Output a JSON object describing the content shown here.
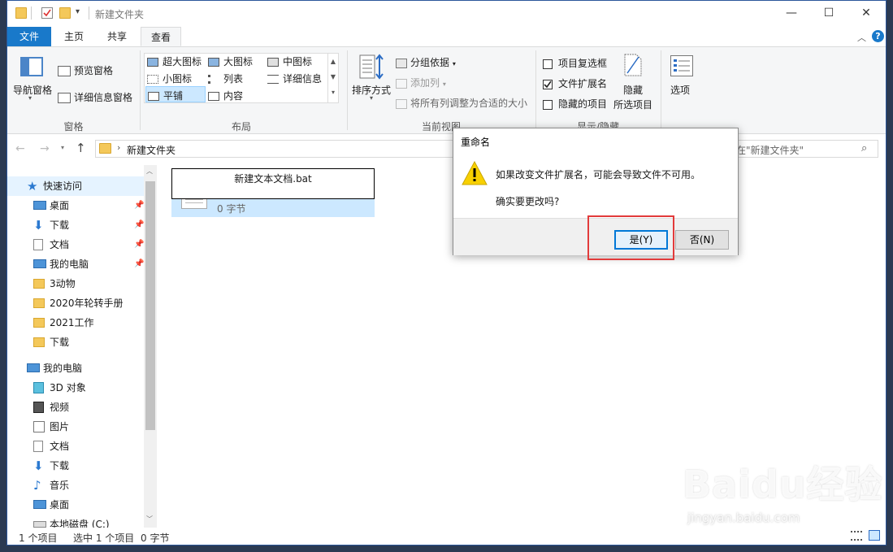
{
  "window": {
    "title": "新建文件夹",
    "controls": {
      "minimize": "—",
      "maximize": "☐",
      "close": "✕"
    }
  },
  "menu": {
    "tabs": [
      "文件",
      "主页",
      "共享",
      "查看"
    ],
    "active_tab": "查看",
    "help": "?"
  },
  "ribbon": {
    "panes": {
      "label": "窗格",
      "nav_pane": "导航窗格",
      "preview_pane": "预览窗格",
      "details_pane": "详细信息窗格"
    },
    "layout": {
      "label": "布局",
      "items": [
        "超大图标",
        "大图标",
        "中图标",
        "小图标",
        "列表",
        "详细信息",
        "平铺",
        "内容"
      ],
      "selected": "平铺"
    },
    "current_view": {
      "label": "当前视图",
      "sort": "排序方式",
      "group_by": "分组依据",
      "add_column": "添加列",
      "fit_columns": "将所有列调整为合适的大小"
    },
    "show_hide": {
      "label": "显示/隐藏",
      "item_checkboxes": {
        "label": "项目复选框",
        "checked": false
      },
      "file_extensions": {
        "label": "文件扩展名",
        "checked": true
      },
      "hidden_items": {
        "label": "隐藏的项目",
        "checked": false
      },
      "hide_selected_line1": "隐藏",
      "hide_selected_line2": "所选项目"
    },
    "options": "选项"
  },
  "navbar": {
    "address": "新建文件夹",
    "search_placeholder": "在\"新建文件夹\""
  },
  "sidebar": {
    "quick_access": "快速访问",
    "quick_items": [
      {
        "label": "桌面",
        "icon": "desktop-icon",
        "pinned": true
      },
      {
        "label": "下载",
        "icon": "download-icon",
        "pinned": true
      },
      {
        "label": "文档",
        "icon": "document-icon",
        "pinned": true
      },
      {
        "label": "我的电脑",
        "icon": "computer-icon",
        "pinned": true
      },
      {
        "label": "3动物",
        "icon": "folder-icon",
        "pinned": false
      },
      {
        "label": "2020年轮转手册",
        "icon": "folder-icon",
        "pinned": false
      },
      {
        "label": "2021工作",
        "icon": "folder-icon",
        "pinned": false
      },
      {
        "label": "下载",
        "icon": "folder-icon",
        "pinned": false
      }
    ],
    "this_pc": "我的电脑",
    "pc_items": [
      {
        "label": "3D 对象",
        "icon": "cube-icon"
      },
      {
        "label": "视频",
        "icon": "video-icon"
      },
      {
        "label": "图片",
        "icon": "picture-icon"
      },
      {
        "label": "文档",
        "icon": "document-icon"
      },
      {
        "label": "下载",
        "icon": "download-icon"
      },
      {
        "label": "音乐",
        "icon": "music-icon"
      },
      {
        "label": "桌面",
        "icon": "desktop-icon"
      },
      {
        "label": "本地磁盘 (C:)",
        "icon": "drive-icon"
      }
    ]
  },
  "file": {
    "rename_value": "新建文本文档.bat",
    "size": "0 字节"
  },
  "status": {
    "items": "1 个项目",
    "selected": "选中 1 个项目",
    "size": "0 字节"
  },
  "dialog": {
    "title": "重命名",
    "message": "如果改变文件扩展名，可能会导致文件不可用。",
    "question": "确实要更改吗?",
    "yes": "是(Y)",
    "no": "否(N)"
  },
  "watermark": {
    "brand": "Baidu经验",
    "url": "jingyan.baidu.com"
  },
  "colors": {
    "accent": "#1979ca",
    "highlight_box": "#e23b3b",
    "selection": "#cce8ff"
  }
}
